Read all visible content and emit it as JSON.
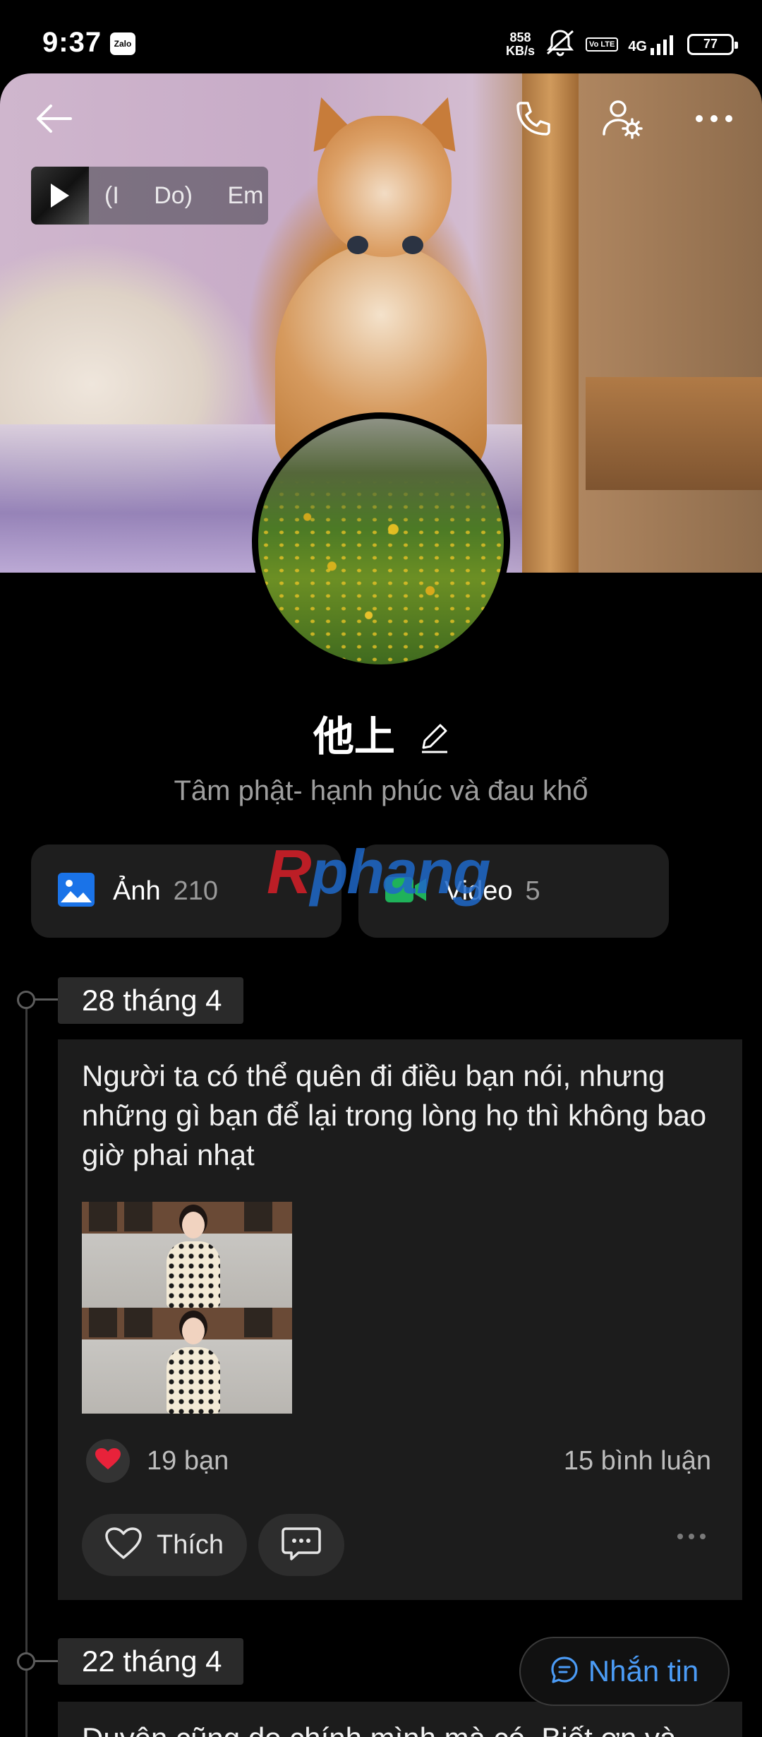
{
  "status_bar": {
    "time": "9:37",
    "app_badge": "Zalo",
    "net_speed_value": "858",
    "net_speed_unit": "KB/s",
    "volte": "Vo LTE",
    "network": "4G",
    "battery": "77"
  },
  "header": {
    "music": {
      "title": "(I Do) Em"
    }
  },
  "profile": {
    "name": "他上",
    "bio": "Tâm phật- hạnh phúc và đau khổ"
  },
  "media": {
    "photos_label": "Ảnh",
    "photos_count": "210",
    "videos_label": "Video",
    "videos_count": "5"
  },
  "watermark": {
    "first": "R",
    "rest": "phang"
  },
  "timeline": {
    "posts": [
      {
        "date": "28 tháng 4",
        "text": "Người ta có thể quên đi điều bạn nói, nhưng những gì bạn để lại trong lòng họ thì không bao giờ phai nhạt",
        "reactions": "19 bạn",
        "comments": "15 bình luận",
        "like_label": "Thích"
      },
      {
        "date": "22 tháng 4",
        "text": "Duyên cũng do chính mình mà có. Biết ơn và"
      }
    ]
  },
  "fab": {
    "label": "Nhắn tin"
  },
  "colors": {
    "accent_blue": "#4b9bf5",
    "photo_icon": "#1a73e8",
    "video_icon": "#1fb25a",
    "heart": "#e8223a"
  }
}
